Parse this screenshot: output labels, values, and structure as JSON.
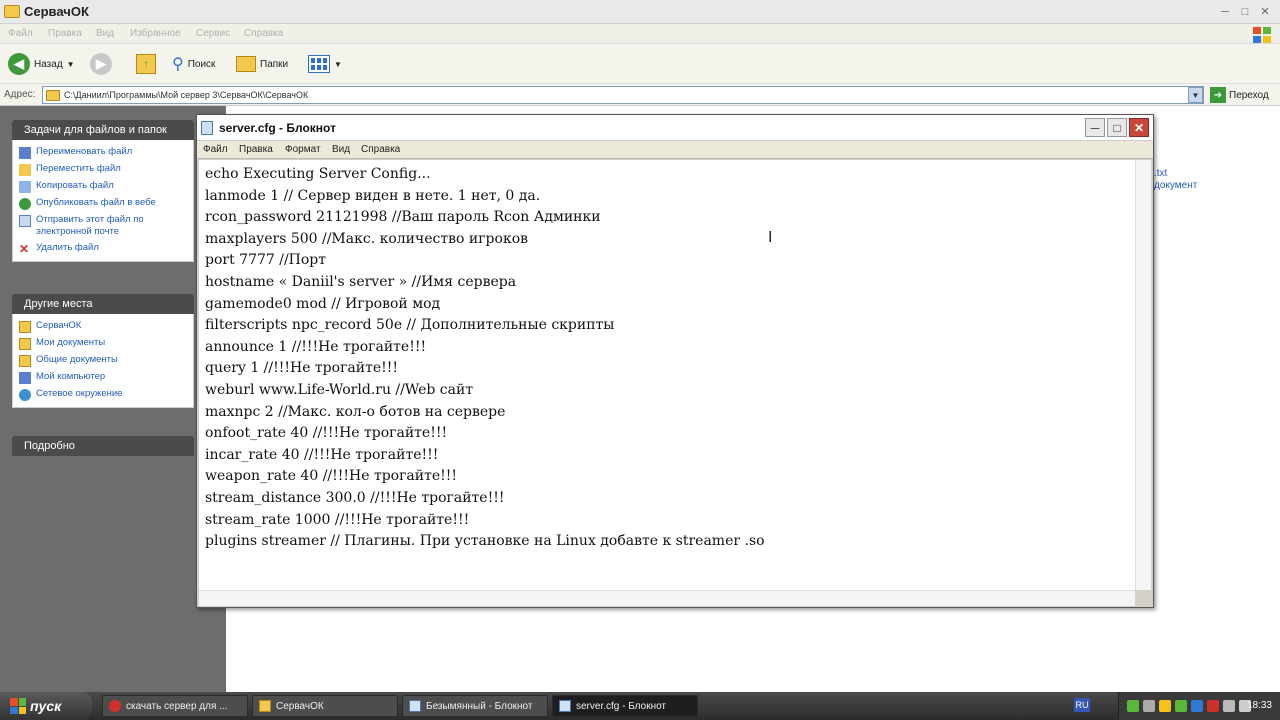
{
  "explorer": {
    "title": "СервачОК",
    "menu": [
      "Файл",
      "Правка",
      "Вид",
      "Избранное",
      "Сервис",
      "Справка"
    ],
    "toolbar": {
      "back": "Назад",
      "search": "Поиск",
      "folders": "Папки"
    },
    "address_label": "Адрес:",
    "address_value": "C:\\Даниил\\Программы\\Мой сервер 3\\СервачОК\\СервачОК",
    "go": "Переход",
    "tasks_header": "Задачи для файлов и папок",
    "tasks": [
      "Переименовать файл",
      "Переместить файл",
      "Копировать файл",
      "Опубликовать файл в вебе",
      "Отправить этот файл по электронной почте",
      "Удалить файл"
    ],
    "places_header": "Другие места",
    "places": [
      "СервачОК",
      "Мои документы",
      "Общие документы",
      "Мой компьютер",
      "Сетевое окружение"
    ],
    "details_header": "Подробно",
    "right_fragment_1": ".txt",
    "right_fragment_2": "документ"
  },
  "notepad": {
    "title": "server.cfg - Блокнот",
    "menu": [
      "Файл",
      "Правка",
      "Формат",
      "Вид",
      "Справка"
    ],
    "lines": [
      "echo Executing Server Config...",
      "lanmode 1 // Сервер виден в нете. 1 нет, 0 да.",
      "rcon_password 21121998 //Ваш пароль Rcon Админки",
      "maxplayers 500 //Макс. количество игроков",
      "port 7777 //Порт",
      "hostname « Daniil's server » //Имя сервера",
      "gamemode0 mod // Игровой мод",
      "filterscripts npc_record 50e // Дополнительные скрипты",
      "announce 1 //!!!Не трогайте!!!",
      "query 1 //!!!Не трогайте!!!",
      "weburl www.Life-World.ru //Web сайт",
      "maxnpc 2 //Макс. кол-о ботов на сервере",
      "onfoot_rate 40 //!!!Не трогайте!!!",
      "incar_rate 40 //!!!Не трогайте!!!",
      "weapon_rate 40 //!!!Не трогайте!!!",
      "stream_distance 300.0 //!!!Не трогайте!!!",
      "stream_rate 1000 //!!!Не трогайте!!!",
      "plugins streamer // Плагины. При установке на Linux добавте к streamer .so"
    ]
  },
  "taskbar": {
    "start": "пуск",
    "buttons": [
      "скачать сервер для ...",
      "СервачОК",
      "Безымянный - Блокнот",
      "server.cfg - Блокнот"
    ],
    "lang": "RU",
    "clock": "18:33"
  },
  "colors": {
    "link": "#215dc6",
    "pane": "#6d6d6d",
    "pane_header": "#4b4b4b",
    "close": "#c8453b"
  }
}
